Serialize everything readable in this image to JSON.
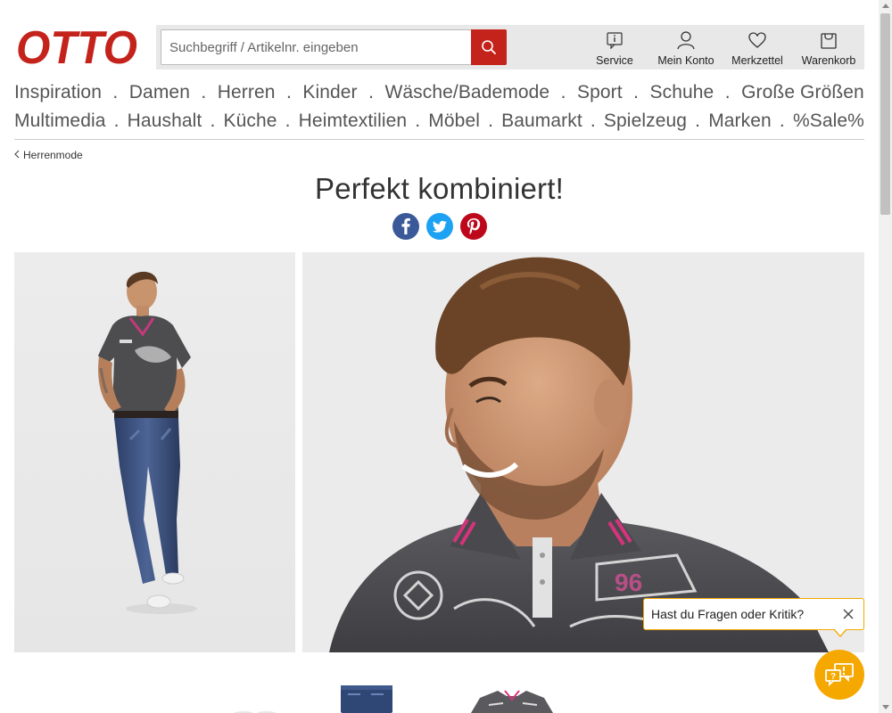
{
  "header": {
    "logo_text": "OTTO",
    "search": {
      "placeholder": "Suchbegriff / Artikelnr. eingeben"
    },
    "nav_icons": [
      {
        "label": "Service",
        "icon": "info-icon"
      },
      {
        "label": "Mein Konto",
        "icon": "user-icon"
      },
      {
        "label": "Merkzettel",
        "icon": "heart-icon"
      },
      {
        "label": "Warenkorb",
        "icon": "bag-icon"
      }
    ]
  },
  "categories": {
    "row1": [
      "Inspiration",
      "Damen",
      "Herren",
      "Kinder",
      "Wäsche/Bademode",
      "Sport",
      "Schuhe",
      "Große Größen"
    ],
    "row2": [
      "Multimedia",
      "Haushalt",
      "Küche",
      "Heimtextilien",
      "Möbel",
      "Baumarkt",
      "Spielzeug",
      "Marken",
      "%Sale%"
    ],
    "separator": "."
  },
  "breadcrumb": {
    "label": "Herrenmode"
  },
  "page": {
    "headline": "Perfekt kombiniert!"
  },
  "social": [
    "facebook-icon",
    "twitter-icon",
    "pinterest-icon"
  ],
  "feedback": {
    "text": "Hast du Fragen oder Kritik?"
  },
  "colors": {
    "brand_red": "#c4231c",
    "accent_yellow": "#f5a800",
    "facebook": "#3b5998",
    "twitter": "#1da1f2",
    "pinterest": "#bd081c"
  }
}
